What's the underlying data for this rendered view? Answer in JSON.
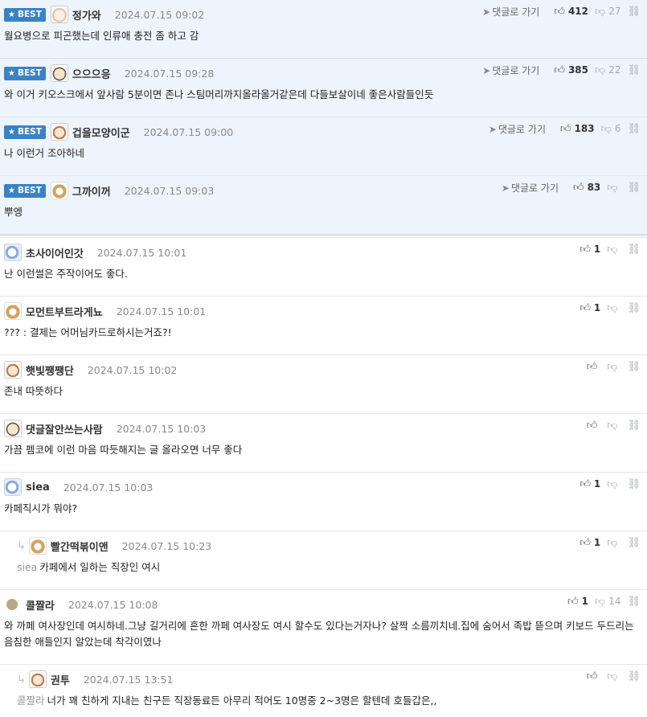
{
  "best": [
    {
      "badge": "BEST",
      "nick": "정가와",
      "date": "2024.07.15 09:02",
      "text": "월요병으로 피곤했는데 인류애 충전 좀 하고 감",
      "goto": "댓글로 가기",
      "up": "412",
      "down": "27",
      "avatar": "dog-icon"
    },
    {
      "badge": "BEST",
      "nick": "으으으응",
      "date": "2024.07.15 09:28",
      "text": "와 이거 키오스크에서 앞사람 5분이면 존나 스팀머리까지올라올거같은데 다들보살이네 좋은사람들인듯",
      "goto": "댓글로 가기",
      "up": "385",
      "down": "22",
      "avatar": "puppy-icon"
    },
    {
      "badge": "BEST",
      "nick": "겁을모양이군",
      "date": "2024.07.15 09:00",
      "text": "나 이런거 조아하네",
      "goto": "댓글로 가기",
      "up": "183",
      "down": "6",
      "avatar": "dog-icon"
    },
    {
      "badge": "BEST",
      "nick": "그까이꺼",
      "date": "2024.07.15 09:03",
      "text": "뿌엥",
      "goto": "댓글로 가기",
      "up": "83",
      "down": "",
      "avatar": "fox-icon"
    }
  ],
  "comments": [
    {
      "nick": "초사이어인갓",
      "date": "2024.07.15 10:01",
      "text": "난 이런썰은 주작이어도 좋다.",
      "up": "1",
      "down": "",
      "avatar": "cat-icon"
    },
    {
      "nick": "모먼트부트라게뇨",
      "date": "2024.07.15 10:01",
      "text": "??? : 결제는 어머님카드로하시는거죠?!",
      "up": "1",
      "down": "",
      "avatar": "fox-icon"
    },
    {
      "nick": "햇빛쨍쨍단",
      "date": "2024.07.15 10:02",
      "text": "존내 따뜻하다",
      "up": "",
      "down": "",
      "avatar": "dog-icon"
    },
    {
      "nick": "댓글잘안쓰는사람",
      "date": "2024.07.15 10:03",
      "text": "가끔 펨코에 이런 마음 따듯해지는 글 올라오면 너무 좋다",
      "up": "",
      "down": "",
      "avatar": "puppy-icon"
    },
    {
      "nick": "siea",
      "date": "2024.07.15 10:03",
      "text": "카페직시가 뭐야?",
      "up": "1",
      "down": "",
      "avatar": "cat-icon"
    },
    {
      "nick": "빨간떡볶이앤",
      "date": "2024.07.15 10:23",
      "mention": "siea",
      "text": "카페에서 일하는 직장인 여시",
      "up": "1",
      "down": "",
      "avatar": "fox-icon",
      "reply": true
    },
    {
      "nick": "콜짤라",
      "date": "2024.07.15 10:08",
      "text": "와 까페 여사장인데 여시하네.그냥 길거리에 흔한 까페 여사장도 여시 할수도 있다는거자나? 살짝 소름끼치네.집에 숨어서 족밥 뜯으며 키보드 두드리는 음침한 애들인지 알았는데 착각이였나",
      "up": "1",
      "down": "14",
      "avatar": "circle-icon",
      "tall": true
    },
    {
      "nick": "권투",
      "date": "2024.07.15 13:51",
      "mention": "콜짤라",
      "text": "너가 꽤 친하게 지내는 친구든 직장동료든 아무리 적어도 10명중 2~3명은 할텐데 호들갑은,,",
      "up": "",
      "down": "",
      "avatar": "dog-icon",
      "reply": true
    }
  ]
}
